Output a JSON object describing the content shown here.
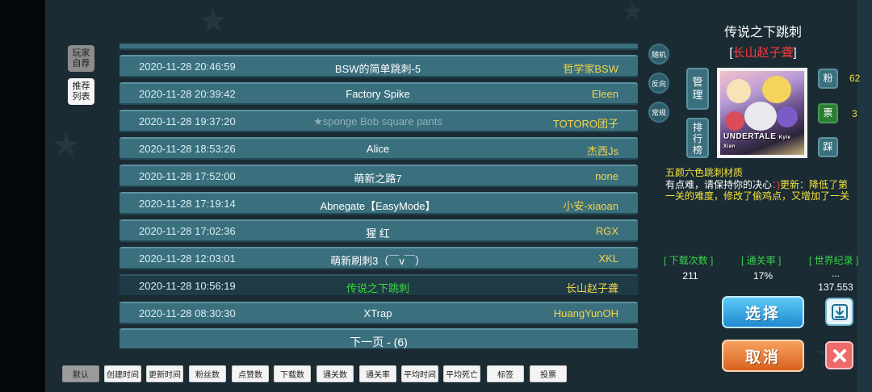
{
  "sidebar": {
    "player_recommend": "玩家\n自荐",
    "recommend_list": "推荐\n列表"
  },
  "levels": [
    {
      "time": "2020-11-28 20:46:59",
      "title": "BSW的简单跳刺-5",
      "author": "哲学家BSW"
    },
    {
      "time": "2020-11-28 20:39:42",
      "title": "Factory Spike",
      "author": "Eleen"
    },
    {
      "time": "2020-11-28 19:37:20",
      "title": "★sponge Bob square pants",
      "author": "TOTORO团子"
    },
    {
      "time": "2020-11-28 18:53:26",
      "title": "Alice",
      "author": "杰西Js"
    },
    {
      "time": "2020-11-28 17:52:00",
      "title": "萌新之路7",
      "author": "none"
    },
    {
      "time": "2020-11-28 17:19:14",
      "title": "Abnegate【EasyMode】",
      "author": "小安-xiaoan"
    },
    {
      "time": "2020-11-28 17:02:36",
      "title": "猩 红",
      "author": "RGX"
    },
    {
      "time": "2020-11-28 12:03:01",
      "title": "萌新刷刺3（￣v￣）",
      "author": "XKL"
    },
    {
      "time": "2020-11-28 10:56:19",
      "title": "传说之下跳刺",
      "author": "长山赵子聋"
    },
    {
      "time": "2020-11-28 08:30:30",
      "title": "XTrap",
      "author": "HuangYunOH"
    }
  ],
  "pagination": {
    "next_label": "下一页 - (6)"
  },
  "modes": {
    "random": "随机",
    "reverse": "反向",
    "normal": "常规"
  },
  "detail": {
    "title": "传说之下跳刺",
    "author_open": "[",
    "author": "长山赵子聋",
    "author_close": "]",
    "manage_label": "管\n理",
    "ranking_label": "排\n行\n榜",
    "fans_label": "粉",
    "fans_count": "62",
    "ticket_label": "票",
    "ticket_count": "3",
    "step_label": "踩",
    "cover_text": "UNDERTALE",
    "cover_sub": "Kyle Xian",
    "desc_line1": "五颜六色跳刺材质",
    "desc_line2a": "有点难，请保持你的决心",
    "desc_line2b": "：)",
    "desc_line2c": "更新：降低了第",
    "desc_line3": "一关的难度，修改了偷鸡点，又增加了一关",
    "stats": {
      "downloads_label": "[ 下载次数 ]",
      "downloads": "211",
      "clear_rate_label": "[ 通关率 ]",
      "clear_rate": "17%",
      "world_record_label": "[ 世界纪录 ]",
      "world_record_holder": "...",
      "world_record": "137.553"
    },
    "select_label": "选择",
    "cancel_label": "取消"
  },
  "sort_buttons": [
    "默认",
    "创建时间",
    "更新时间",
    "粉丝数",
    "点赞数",
    "下载数",
    "通关数",
    "通关率",
    "平均时间",
    "平均死亡",
    "标签",
    "投票"
  ],
  "colors": {
    "background": "#1b2b34",
    "row": "#3a6f7e",
    "author_yellow": "#f2d44a",
    "selected_title_green": "#38d93a",
    "stat_green": "#37d24a"
  }
}
